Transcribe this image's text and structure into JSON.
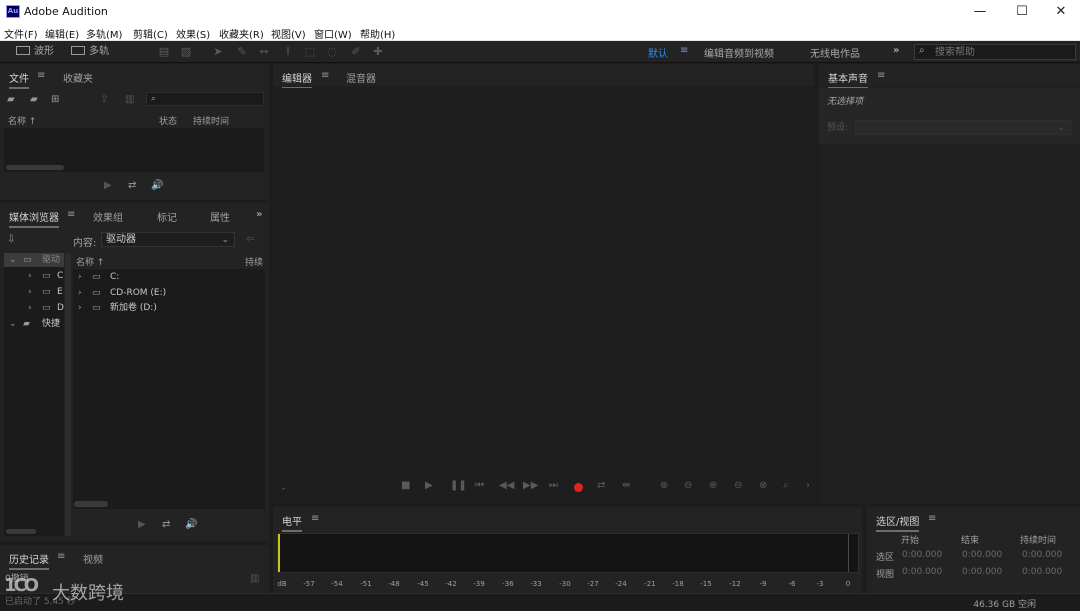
{
  "window": {
    "title": "Adobe Audition",
    "app_icon_text": "Au",
    "controls": {
      "minimize": "—",
      "maximize": "☐",
      "close": "✕"
    }
  },
  "menubar": [
    "文件(F)",
    "编辑(E)",
    "多轨(M)",
    "剪辑(C)",
    "效果(S)",
    "收藏夹(R)",
    "视图(V)",
    "窗口(W)",
    "帮助(H)"
  ],
  "toolbar": {
    "waveform_label": "波形",
    "multitrack_label": "多轨",
    "workspaces": [
      "默认",
      "编辑音频到视频",
      "无线电作品"
    ],
    "active_workspace": "默认",
    "overflow": "»",
    "search_placeholder": "搜索帮助"
  },
  "files_panel": {
    "tabs": [
      "文件",
      "收藏夹"
    ],
    "columns": {
      "name": "名称 ↑",
      "status": "状态",
      "duration": "持续时间"
    }
  },
  "media_browser": {
    "tabs": [
      "媒体浏览器",
      "效果组",
      "标记",
      "属性"
    ],
    "overflow": "»",
    "content_label": "内容:",
    "content_value": "驱动器",
    "tree": [
      {
        "label": "驱动",
        "level": 0,
        "expanded": true
      },
      {
        "label": "C",
        "level": 1
      },
      {
        "label": "E",
        "level": 1
      },
      {
        "label": "D",
        "level": 1
      },
      {
        "label": "快捷",
        "level": 0,
        "expanded": true
      }
    ],
    "list_columns": {
      "name": "名称 ↑",
      "duration": "持续"
    },
    "drives": [
      "C:",
      "CD-ROM (E:)",
      "新加卷 (D:)"
    ]
  },
  "editor": {
    "tabs": [
      "编辑器",
      "混音器"
    ],
    "time_placeholder": "-"
  },
  "basic_sound": {
    "title": "基本声音",
    "no_selection": "无选择项",
    "preset_label": "预设:"
  },
  "history": {
    "tabs": [
      "历史记录",
      "视频"
    ],
    "undo_text": "0撤销",
    "started_text": "已启动了 5.45 秒"
  },
  "level_meter": {
    "title": "电平",
    "ticks": [
      "dB",
      "-57",
      "-54",
      "-51",
      "-48",
      "-45",
      "-42",
      "-39",
      "-36",
      "-33",
      "-30",
      "-27",
      "-24",
      "-21",
      "-18",
      "-15",
      "-12",
      "-9",
      "-6",
      "-3",
      "0"
    ]
  },
  "selection_view": {
    "title": "选区/视图",
    "columns": [
      "开始",
      "结束",
      "持续时间"
    ],
    "rows": [
      {
        "label": "选区",
        "start": "0:00.000",
        "end": "0:00.000",
        "duration": "0:00.000"
      },
      {
        "label": "视图",
        "start": "0:00.000",
        "end": "0:00.000",
        "duration": "0:00.000"
      }
    ]
  },
  "status": {
    "free_space": "46.36 GB 空闲"
  },
  "watermark": {
    "logo": "1CO",
    "text": "大数跨境"
  }
}
